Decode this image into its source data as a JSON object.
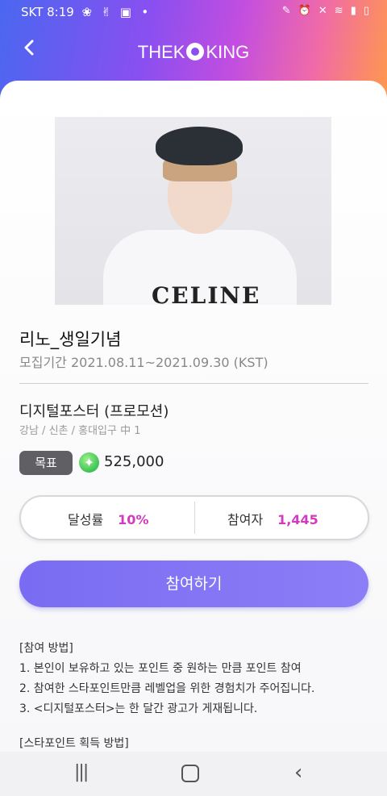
{
  "status_bar": {
    "carrier_time": "SKT 8:19",
    "left_icons": [
      "swirl-icon",
      "peace-hand-icon",
      "image-icon",
      "dot-icon"
    ],
    "right_icons": [
      "pen-icon",
      "alarm-icon",
      "mute-icon",
      "wifi-icon",
      "signal-icon",
      "battery-icon"
    ]
  },
  "header": {
    "back_label": "‹",
    "logo_left": "THEK",
    "logo_right": "KING"
  },
  "event": {
    "title": "리노_생일기념",
    "period": "모집기간 2021.08.11~2021.09.30 (KST)",
    "product_name": "디지털포스터 (프로모션)",
    "location": "강남 / 신촌 / 홍대입구 中 1",
    "photo_text": "CELINE"
  },
  "goal": {
    "badge_label": "목표",
    "value": "525,000"
  },
  "stats": {
    "rate_label": "달성률",
    "rate_value": "10%",
    "participants_label": "참여자",
    "participants_value": "1,445"
  },
  "join_button": "참여하기",
  "howto": {
    "heading": "[참여 방법]",
    "lines": [
      "1. 본인이 보유하고 있는 포인트 중 원하는 만큼 포인트 참여",
      "2. 참여한 스타포인트만큼 레벨업을 위한 경험치가 주어집니다.",
      "3. <디지털포스터>는 한 달간 광고가 게재됩니다."
    ],
    "next_heading": "[스타포인트 획득 방법]"
  },
  "nav_bar": {
    "recent_label": "|||",
    "back_label": "‹"
  },
  "colors": {
    "accent_purple": "#7a6cf2",
    "stat_pink": "#d13bc0",
    "badge_gray": "#5f5f64"
  }
}
